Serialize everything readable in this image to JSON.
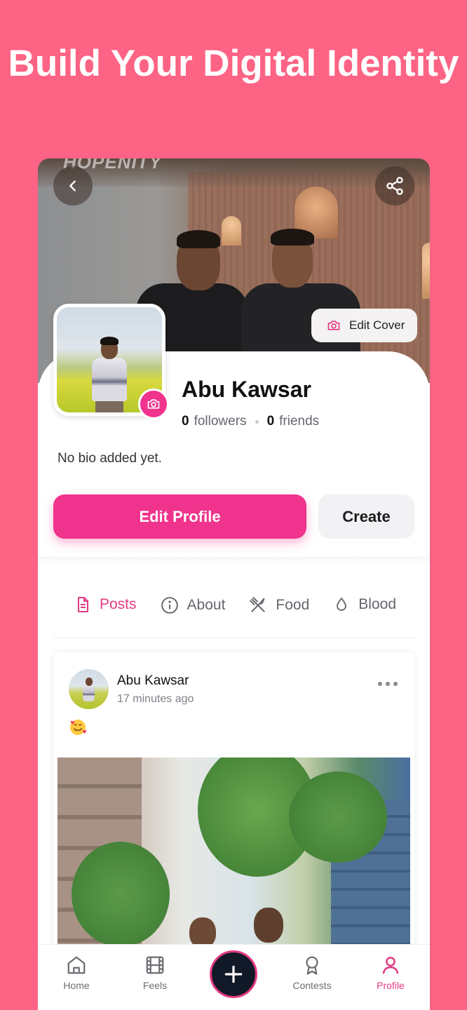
{
  "headline": "Build Your Digital Identity",
  "cover": {
    "watermark": "HOPENITY",
    "edit_cover_label": "Edit Cover"
  },
  "profile": {
    "name": "Abu Kawsar",
    "followers_count": "0",
    "followers_label": "followers",
    "friends_count": "0",
    "friends_label": "friends",
    "bio": "No bio added yet."
  },
  "actions": {
    "edit_profile": "Edit Profile",
    "create": "Create"
  },
  "tabs": [
    {
      "label": "Posts",
      "icon": "document-icon",
      "active": true
    },
    {
      "label": "About",
      "icon": "info-icon",
      "active": false
    },
    {
      "label": "Food",
      "icon": "fork-knife-icon",
      "active": false
    },
    {
      "label": "Blood",
      "icon": "drop-icon",
      "active": false
    }
  ],
  "post": {
    "author": "Abu Kawsar",
    "time": "17 minutes ago",
    "content": "🥰"
  },
  "bottom_nav": [
    {
      "label": "Home",
      "icon": "home-icon",
      "active": false
    },
    {
      "label": "Feels",
      "icon": "film-icon",
      "active": false
    },
    {
      "label": "",
      "icon": "plus-icon",
      "active": false
    },
    {
      "label": "Contests",
      "icon": "award-icon",
      "active": false
    },
    {
      "label": "Profile",
      "icon": "user-icon",
      "active": true
    }
  ],
  "colors": {
    "background": "#fd6384",
    "accent": "#f0338c",
    "active_tab": "#e23b82",
    "fab": "#111827"
  }
}
